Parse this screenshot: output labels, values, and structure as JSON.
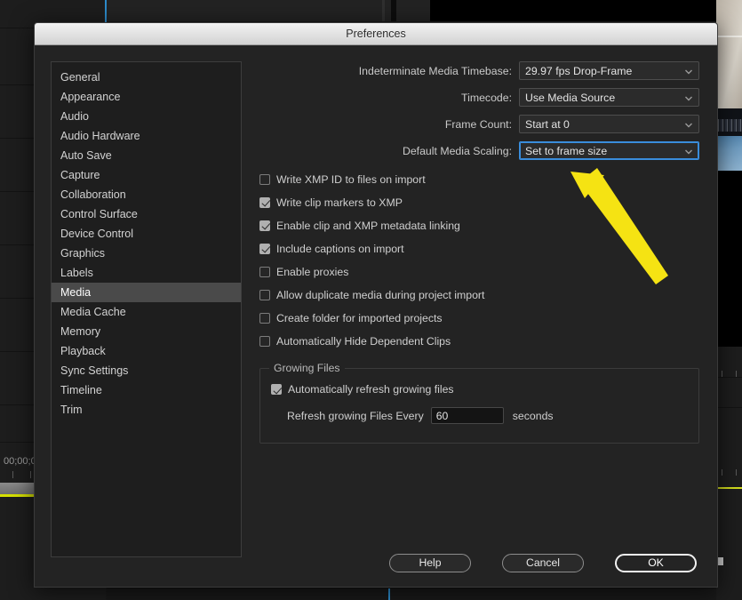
{
  "window": {
    "title": "Preferences"
  },
  "sidebar": {
    "items": [
      {
        "label": "General",
        "selected": false
      },
      {
        "label": "Appearance",
        "selected": false
      },
      {
        "label": "Audio",
        "selected": false
      },
      {
        "label": "Audio Hardware",
        "selected": false
      },
      {
        "label": "Auto Save",
        "selected": false
      },
      {
        "label": "Capture",
        "selected": false
      },
      {
        "label": "Collaboration",
        "selected": false
      },
      {
        "label": "Control Surface",
        "selected": false
      },
      {
        "label": "Device Control",
        "selected": false
      },
      {
        "label": "Graphics",
        "selected": false
      },
      {
        "label": "Labels",
        "selected": false
      },
      {
        "label": "Media",
        "selected": true
      },
      {
        "label": "Media Cache",
        "selected": false
      },
      {
        "label": "Memory",
        "selected": false
      },
      {
        "label": "Playback",
        "selected": false
      },
      {
        "label": "Sync Settings",
        "selected": false
      },
      {
        "label": "Timeline",
        "selected": false
      },
      {
        "label": "Trim",
        "selected": false
      }
    ]
  },
  "media_panel": {
    "selects": [
      {
        "label": "Indeterminate Media Timebase:",
        "value": "29.97 fps Drop-Frame",
        "focused": false
      },
      {
        "label": "Timecode:",
        "value": "Use Media Source",
        "focused": false
      },
      {
        "label": "Frame Count:",
        "value": "Start at 0",
        "focused": false
      },
      {
        "label": "Default Media Scaling:",
        "value": "Set to frame size",
        "focused": true
      }
    ],
    "checkboxes": [
      {
        "label": "Write XMP ID to files on import",
        "checked": false
      },
      {
        "label": "Write clip markers to XMP",
        "checked": true
      },
      {
        "label": "Enable clip and XMP metadata linking",
        "checked": true
      },
      {
        "label": "Include captions on import",
        "checked": true
      },
      {
        "label": "Enable proxies",
        "checked": false
      },
      {
        "label": "Allow duplicate media during project import",
        "checked": false
      },
      {
        "label": "Create folder for imported projects",
        "checked": false
      },
      {
        "label": "Automatically Hide Dependent Clips",
        "checked": false
      }
    ],
    "growing_files": {
      "title": "Growing Files",
      "auto_refresh": {
        "label": "Automatically refresh growing files",
        "checked": true
      },
      "interval_label": "Refresh growing Files Every",
      "interval_value": "60",
      "interval_unit": "seconds"
    }
  },
  "footer": {
    "help_label": "Help",
    "cancel_label": "Cancel",
    "ok_label": "OK"
  },
  "background": {
    "timecode": "00;00;0",
    "playhead_color": "#2d8ccc",
    "accent_yellow": "#d2dc1e"
  },
  "annotation": {
    "arrow_color": "#f5e313",
    "arrow_points_to": "Default Media Scaling:"
  }
}
